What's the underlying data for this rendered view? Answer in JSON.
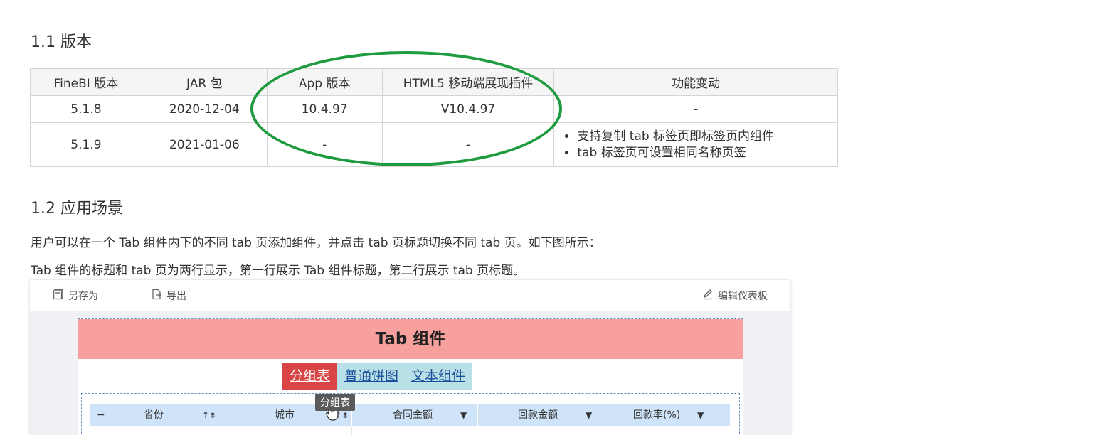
{
  "section_version": {
    "title": "1.1 版本"
  },
  "version_table": {
    "headers": [
      "FineBI 版本",
      "JAR 包",
      "App 版本",
      "HTML5 移动端展现插件",
      "功能变动"
    ],
    "rows": [
      {
        "finebi": "5.1.8",
        "jar": "2020-12-04",
        "app": "10.4.97",
        "html5": "V10.4.97",
        "change": "-"
      },
      {
        "finebi": "5.1.9",
        "jar": "2021-01-06",
        "app": "-",
        "html5": "-",
        "changes": [
          "支持复制 tab 标签页即标签页内组件",
          "tab 标签页可设置相同名称页签"
        ]
      }
    ],
    "highlight_color": "#1e9b3e"
  },
  "section_scenario": {
    "title": "1.2 应用场景",
    "paragraphs": [
      "用户可以在一个 Tab 组件内下的不同 tab 页添加组件，并点击 tab 页标题切换不同 tab 页。如下图所示：",
      "Tab 组件的标题和 tab 页为两行显示，第一行展示 Tab 组件标题，第二行展示 tab 页标题。"
    ]
  },
  "screenshot": {
    "toolbar": {
      "save_as": "另存为",
      "export": "导出",
      "edit_dashboard": "编辑仪表板"
    },
    "tab_component": {
      "title": "Tab 组件",
      "title_bg": "#f7a09e",
      "tabs": [
        "分组表",
        "普通饼图",
        "文本组件"
      ],
      "active_tab": "分组表",
      "active_color": "#d94545",
      "inactive_color": "#b9e0e6",
      "tooltip": "分组表"
    },
    "table_header": {
      "collapse": "−",
      "columns": [
        "省份",
        "城市",
        "合同金额",
        "回款金额",
        "回款率(%)"
      ],
      "sort_glyph": "↑⇟",
      "filter_glyph": "▼"
    }
  }
}
